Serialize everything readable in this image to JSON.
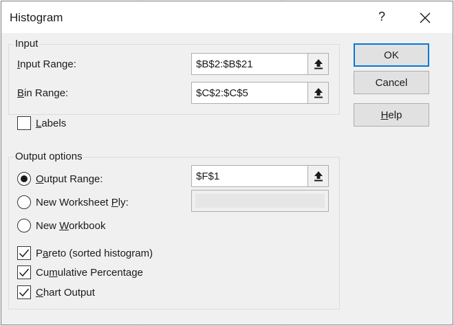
{
  "dialog": {
    "title": "Histogram",
    "help_glyph": "?"
  },
  "input_group": {
    "title": "Input",
    "input_range": {
      "label_prefix": "",
      "label_ul": "I",
      "label_rest": "nput Range:",
      "value": "$B$2:$B$21"
    },
    "bin_range": {
      "label_prefix": "",
      "label_ul": "B",
      "label_rest": "in Range:",
      "value": "$C$2:$C$5"
    }
  },
  "labels_checkbox": {
    "label_prefix": "",
    "label_ul": "L",
    "label_rest": "abels",
    "checked": false
  },
  "output_group": {
    "title": "Output options",
    "output_range": {
      "label_prefix": "",
      "label_ul": "O",
      "label_rest": "utput Range:",
      "value": "$F$1",
      "selected": true
    },
    "new_worksheet": {
      "label_prefix": "New Worksheet ",
      "label_ul": "P",
      "label_rest": "ly:",
      "selected": false
    },
    "new_workbook": {
      "label_prefix": "New ",
      "label_ul": "W",
      "label_rest": "orkbook",
      "selected": false
    },
    "pareto": {
      "label_prefix": "P",
      "label_ul": "a",
      "label_rest": "reto (sorted histogram)",
      "checked": true
    },
    "cumulative": {
      "label_prefix": "Cu",
      "label_ul": "m",
      "label_rest": "ulative Percentage",
      "checked": true
    },
    "chart_output": {
      "label_prefix": "",
      "label_ul": "C",
      "label_rest": "hart Output",
      "checked": true
    }
  },
  "buttons": {
    "ok": "OK",
    "cancel": "Cancel",
    "help_ul": "H",
    "help_rest": "elp"
  },
  "icons": {
    "collapse": "up-arrow-collapse-icon",
    "check": "checkmark-icon",
    "close": "close-icon"
  },
  "colors": {
    "dialog_bg": "#f0f0f0",
    "titlebar_bg": "#ffffff",
    "ok_border": "#0078d7"
  }
}
